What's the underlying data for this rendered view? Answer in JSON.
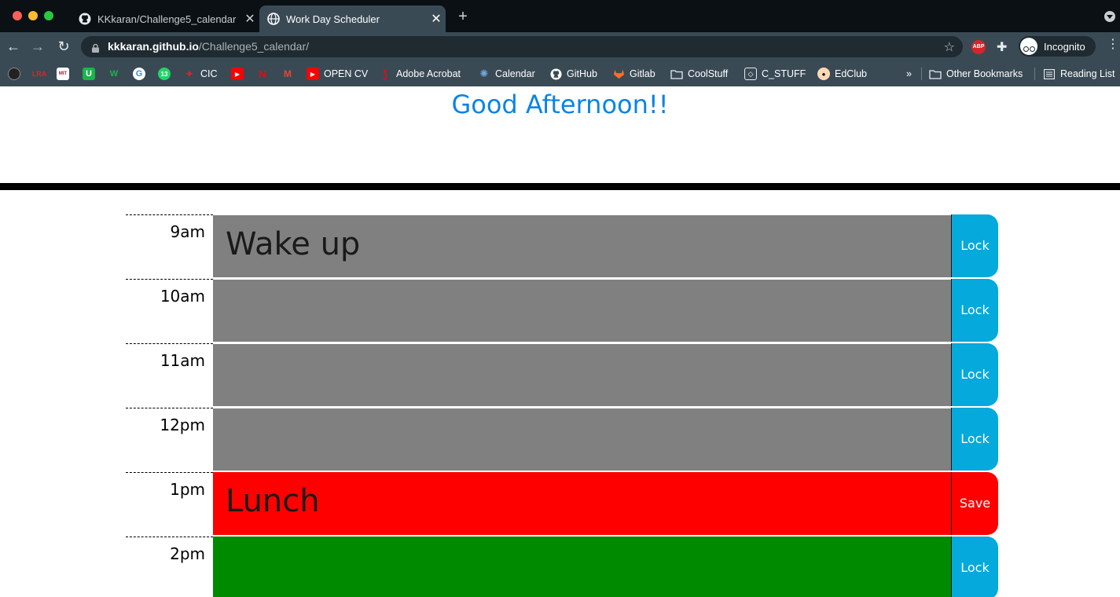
{
  "browser": {
    "tabs": [
      {
        "title": "KKkaran/Challenge5_calendar",
        "active": false
      },
      {
        "title": "Work Day Scheduler",
        "active": true
      }
    ],
    "url_host": "kkkaran.github.io",
    "url_path": "/Challenge5_calendar/",
    "profile_label": "Incognito",
    "bookmarks": [
      {
        "label": "CIC"
      },
      {
        "label": "OPEN CV"
      },
      {
        "label": "Adobe Acrobat"
      },
      {
        "label": "Calendar"
      },
      {
        "label": "GitHub"
      },
      {
        "label": "Gitlab"
      },
      {
        "label": "CoolStuff"
      },
      {
        "label": "C_STUFF"
      },
      {
        "label": "EdClub"
      }
    ],
    "bookmark_icon_texts": {
      "lra": "LRA",
      "mit": "MIT",
      "u": "U",
      "w": "W",
      "thirteen": "13"
    },
    "other_bookmarks": "Other Bookmarks",
    "reading_list": "Reading List",
    "overflow": "»",
    "abp_label": "ABP"
  },
  "scheduler": {
    "greeting": "Good Afternoon!!",
    "colors": {
      "past": "#808080",
      "present": "#ff0000",
      "future": "#008a00",
      "lock_button": "#05a9dc",
      "greeting": "#0b84e6"
    },
    "rows": [
      {
        "hour": "9am",
        "text": "Wake up",
        "state": "past",
        "button": "Lock"
      },
      {
        "hour": "10am",
        "text": "",
        "state": "past",
        "button": "Lock"
      },
      {
        "hour": "11am",
        "text": "",
        "state": "past",
        "button": "Lock"
      },
      {
        "hour": "12pm",
        "text": "",
        "state": "past",
        "button": "Lock"
      },
      {
        "hour": "1pm",
        "text": "Lunch",
        "state": "present",
        "button": "Save"
      },
      {
        "hour": "2pm",
        "text": "",
        "state": "future",
        "button": "Lock"
      }
    ]
  }
}
